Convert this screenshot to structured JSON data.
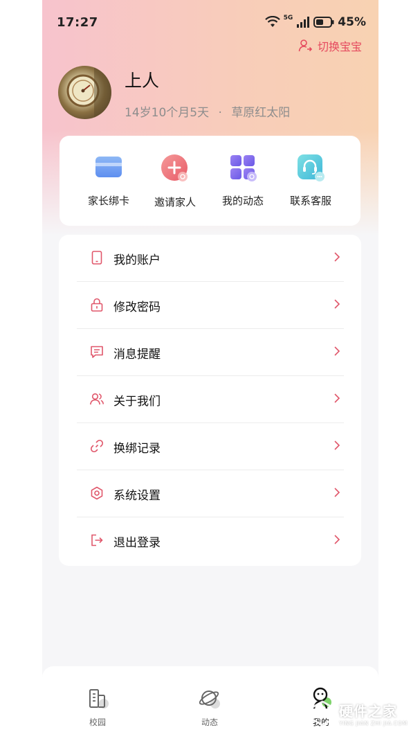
{
  "status_bar": {
    "time": "17:27",
    "network": "5G",
    "battery": "45%"
  },
  "header": {
    "switch_baby_label": "切换宝宝",
    "username": "上人",
    "age": "14岁10个月5天",
    "separator": "·",
    "class_name": "草原红太阳"
  },
  "quick_actions": [
    {
      "label": "家长绑卡",
      "icon": "card-icon"
    },
    {
      "label": "邀请家人",
      "icon": "invite-plus-icon"
    },
    {
      "label": "我的动态",
      "icon": "grid-icon"
    },
    {
      "label": "联系客服",
      "icon": "headset-icon"
    }
  ],
  "menu": [
    {
      "label": "我的账户",
      "icon": "phone-icon"
    },
    {
      "label": "修改密码",
      "icon": "lock-icon"
    },
    {
      "label": "消息提醒",
      "icon": "message-icon"
    },
    {
      "label": "关于我们",
      "icon": "users-icon"
    },
    {
      "label": "换绑记录",
      "icon": "link-icon"
    },
    {
      "label": "系统设置",
      "icon": "settings-hexagon-icon"
    },
    {
      "label": "退出登录",
      "icon": "logout-icon"
    }
  ],
  "tabbar": [
    {
      "label": "校园",
      "icon": "building-icon",
      "active": false
    },
    {
      "label": "动态",
      "icon": "planet-icon",
      "active": false
    },
    {
      "label": "我的",
      "icon": "profile-face-icon",
      "active": true
    }
  ],
  "watermark": {
    "cn": "硬件之家",
    "en": "YING JIAN ZHI JIA.COM"
  },
  "colors": {
    "accent": "#e5495e",
    "icon_red": "#e0566a",
    "background": "#f6f6f8"
  }
}
